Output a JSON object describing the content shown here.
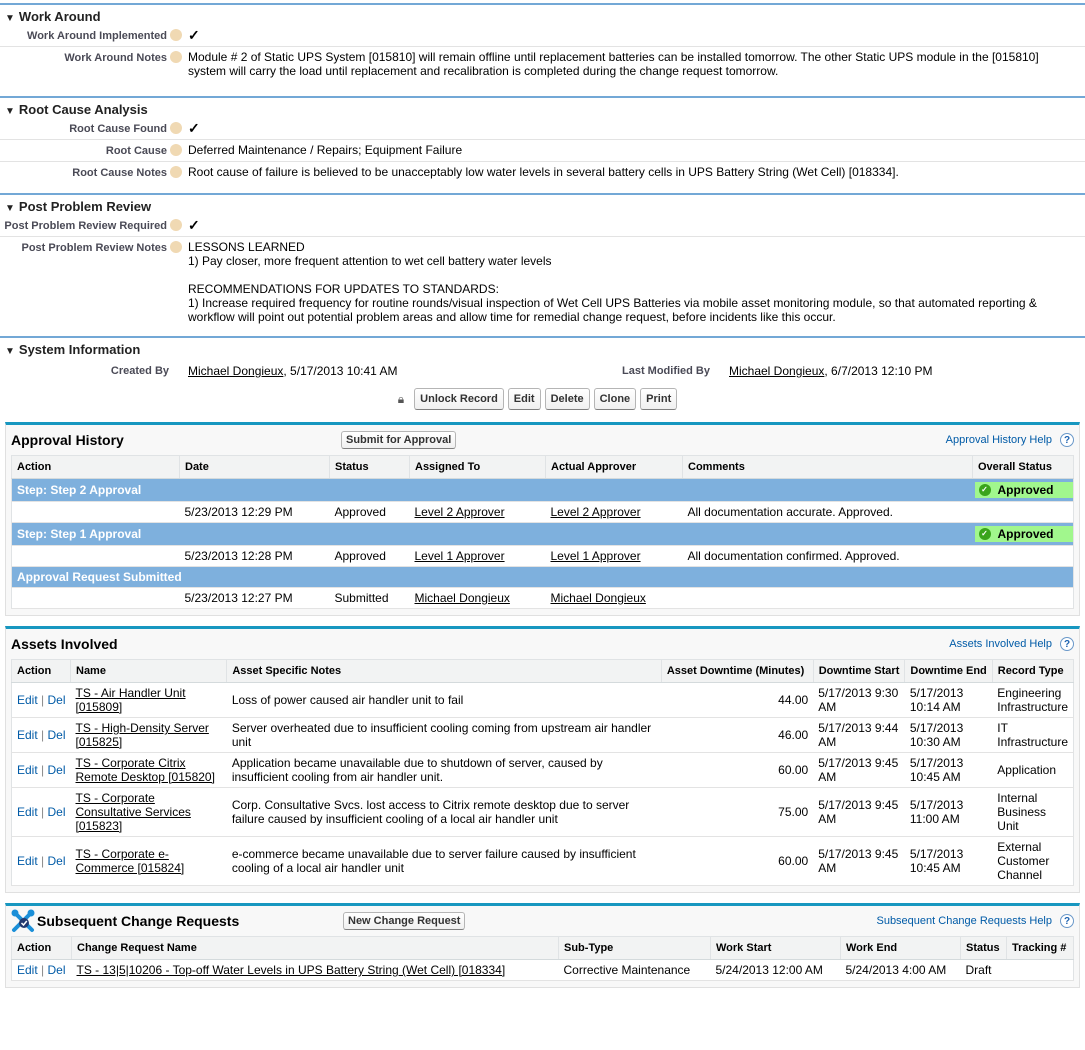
{
  "work_around": {
    "title": "Work Around",
    "fields": [
      {
        "label": "Work Around Implemented",
        "value": "✓"
      },
      {
        "label": "Work Around Notes",
        "value": "Module # 2 of Static UPS System [015810] will remain offline until replacement batteries can be installed tomorrow. The other Static UPS module in the [015810] system will carry the load until replacement and recalibration is completed during the change request tomorrow."
      }
    ]
  },
  "root_cause": {
    "title": "Root Cause Analysis",
    "fields": [
      {
        "label": "Root Cause Found",
        "value": "✓"
      },
      {
        "label": "Root Cause",
        "value": "Deferred Maintenance / Repairs; Equipment Failure"
      },
      {
        "label": "Root Cause Notes",
        "value": "Root cause of failure is believed to be unacceptably low water levels in several battery cells in UPS Battery String (Wet Cell) [018334]."
      }
    ]
  },
  "post_problem": {
    "title": "Post Problem Review",
    "fields": [
      {
        "label": "Post Problem Review Required",
        "value": "✓"
      },
      {
        "label": "Post Problem Review Notes",
        "lines": [
          "LESSONS LEARNED",
          "1) Pay closer, more frequent attention to wet cell battery water levels",
          "",
          "RECOMMENDATIONS FOR UPDATES TO STANDARDS:",
          "1) Increase required frequency for routine rounds/visual inspection of Wet Cell UPS Batteries via mobile asset monitoring module, so that automated reporting & workflow will point out potential problem areas and allow time for remedial change request, before incidents like this occur."
        ]
      }
    ]
  },
  "system_info": {
    "title": "System Information",
    "created_by_label": "Created By",
    "created_by_user": "Michael Dongieux",
    "created_by_date": ", 5/17/2013 10:41 AM",
    "modified_by_label": "Last Modified By",
    "modified_by_user": "Michael Dongieux",
    "modified_by_date": ", 6/7/2013 12:10 PM"
  },
  "buttons": {
    "unlock": "Unlock Record",
    "edit": "Edit",
    "delete": "Delete",
    "clone": "Clone",
    "print": "Print"
  },
  "approval_history": {
    "title": "Approval History",
    "submit_button": "Submit for Approval",
    "help_link": "Approval History Help",
    "columns": [
      "Action",
      "Date",
      "Status",
      "Assigned To",
      "Actual Approver",
      "Comments",
      "Overall Status"
    ],
    "groups": [
      {
        "step": "Step: Step 2 Approval",
        "overall_status": "Approved",
        "date": "5/23/2013 12:29 PM",
        "status": "Approved",
        "assigned_to": "Level 2 Approver",
        "actual_approver": "Level 2 Approver",
        "comments": "All documentation accurate. Approved."
      },
      {
        "step": "Step: Step 1 Approval",
        "overall_status": "Approved",
        "date": "5/23/2013 12:28 PM",
        "status": "Approved",
        "assigned_to": "Level 1 Approver",
        "actual_approver": "Level 1 Approver",
        "comments": "All documentation confirmed. Approved."
      },
      {
        "step": "Approval Request Submitted",
        "overall_status": "",
        "date": "5/23/2013 12:27 PM",
        "status": "Submitted",
        "assigned_to": "Michael Dongieux",
        "actual_approver": "Michael Dongieux",
        "comments": ""
      }
    ]
  },
  "assets": {
    "title": "Assets Involved",
    "help_link": "Assets Involved Help",
    "columns": [
      "Action",
      "Name",
      "Asset Specific Notes",
      "Asset Downtime (Minutes)",
      "Downtime Start",
      "Downtime End",
      "Record Type"
    ],
    "edit_label": "Edit",
    "del_label": "Del",
    "rows": [
      {
        "name": "TS - Air Handler Unit [015809]",
        "notes": "Loss of power caused air handler unit to fail",
        "downtime": "44.00",
        "start": "5/17/2013 9:30 AM",
        "end": "5/17/2013 10:14 AM",
        "record_type": "Engineering Infrastructure"
      },
      {
        "name": "TS - High-Density Server [015825]",
        "notes": "Server overheated due to insufficient cooling coming from upstream air handler unit",
        "downtime": "46.00",
        "start": "5/17/2013 9:44 AM",
        "end": "5/17/2013 10:30 AM",
        "record_type": "IT Infrastructure"
      },
      {
        "name": "TS - Corporate Citrix Remote Desktop [015820]",
        "notes": "Application became unavailable due to shutdown of server, caused by insufficient cooling from air handler unit.",
        "downtime": "60.00",
        "start": "5/17/2013 9:45 AM",
        "end": "5/17/2013 10:45 AM",
        "record_type": "Application"
      },
      {
        "name": "TS - Corporate Consultative Services [015823]",
        "notes": "Corp. Consultative Svcs. lost access to Citrix remote desktop due to server failure caused by insufficient cooling of a local air handler unit",
        "downtime": "75.00",
        "start": "5/17/2013 9:45 AM",
        "end": "5/17/2013 11:00 AM",
        "record_type": "Internal Business Unit"
      },
      {
        "name": "TS - Corporate e-Commerce [015824]",
        "notes": "e-commerce became unavailable due to server failure caused by insufficient cooling of a local air handler unit",
        "downtime": "60.00",
        "start": "5/17/2013 9:45 AM",
        "end": "5/17/2013 10:45 AM",
        "record_type": "External Customer Channel"
      }
    ]
  },
  "change_requests": {
    "title": "Subsequent Change Requests",
    "new_button": "New Change Request",
    "help_link": "Subsequent Change Requests Help",
    "columns": [
      "Action",
      "Change Request Name",
      "Sub-Type",
      "Work Start",
      "Work End",
      "Status",
      "Tracking #"
    ],
    "edit_label": "Edit",
    "del_label": "Del",
    "rows": [
      {
        "name": "TS - 13|5|10206 - Top-off Water Levels in UPS Battery String (Wet Cell) [018334]",
        "sub_type": "Corrective Maintenance",
        "work_start": "5/24/2013 12:00 AM",
        "work_end": "5/24/2013 4:00 AM",
        "status": "Draft",
        "tracking": ""
      }
    ]
  },
  "colors": {
    "section_rule": "#73a8d6",
    "related_list_border": "#1797c0",
    "step_row": "#7eb0dd",
    "approved_badge": "#a1f78d",
    "link_blue": "#015ba7"
  }
}
